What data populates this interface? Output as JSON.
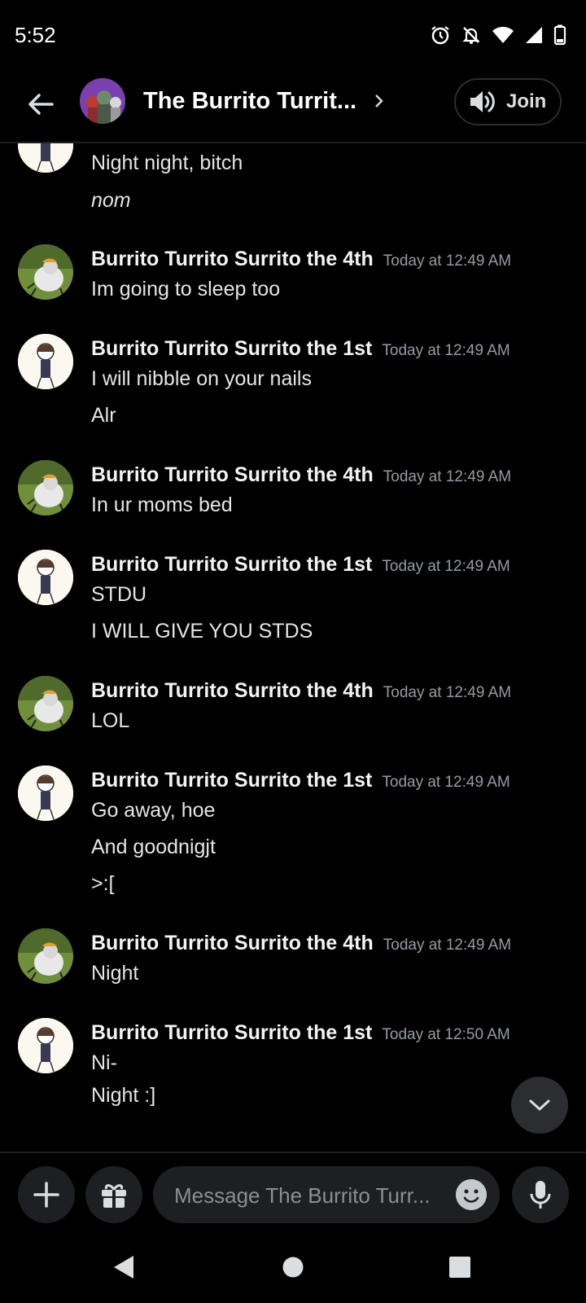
{
  "status_bar": {
    "time": "5:52"
  },
  "header": {
    "channel_title": "The Burrito Turrit...",
    "join_label": "Join"
  },
  "messages": {
    "top_continuation": [
      "Night night, bitch",
      "nom"
    ],
    "groups": [
      {
        "author": "Burrito Turrito Surrito the 4th",
        "timestamp": "Today at 12:49 AM",
        "lines": [
          "Im going to sleep too"
        ]
      },
      {
        "author": "Burrito Turrito Surrito the 1st",
        "timestamp": "Today at 12:49 AM",
        "lines": [
          "I will nibble on your nails",
          "Alr"
        ]
      },
      {
        "author": "Burrito Turrito Surrito the 4th",
        "timestamp": "Today at 12:49 AM",
        "lines": [
          "In ur moms bed"
        ]
      },
      {
        "author": "Burrito Turrito Surrito the 1st",
        "timestamp": "Today at 12:49 AM",
        "lines": [
          "STDU",
          "I WILL GIVE YOU STDS"
        ]
      },
      {
        "author": "Burrito Turrito Surrito the 4th",
        "timestamp": "Today at 12:49 AM",
        "lines": [
          "LOL"
        ]
      },
      {
        "author": "Burrito Turrito Surrito the 1st",
        "timestamp": "Today at 12:49 AM",
        "lines": [
          "Go away, hoe",
          "And goodnigjt",
          ">:["
        ]
      },
      {
        "author": "Burrito Turrito Surrito the 4th",
        "timestamp": "Today at 12:49 AM",
        "lines": [
          "Night"
        ]
      },
      {
        "author": "Burrito Turrito Surrito the 1st",
        "timestamp": "Today at 12:50 AM",
        "lines": [
          "Ni-",
          "Night :]"
        ]
      }
    ]
  },
  "composer": {
    "placeholder": "Message The Burrito Turr..."
  },
  "colors": {
    "background": "#000000",
    "surface": "#1e1f22",
    "timestamp": "#949ba4",
    "text": "#e3e5e8"
  }
}
